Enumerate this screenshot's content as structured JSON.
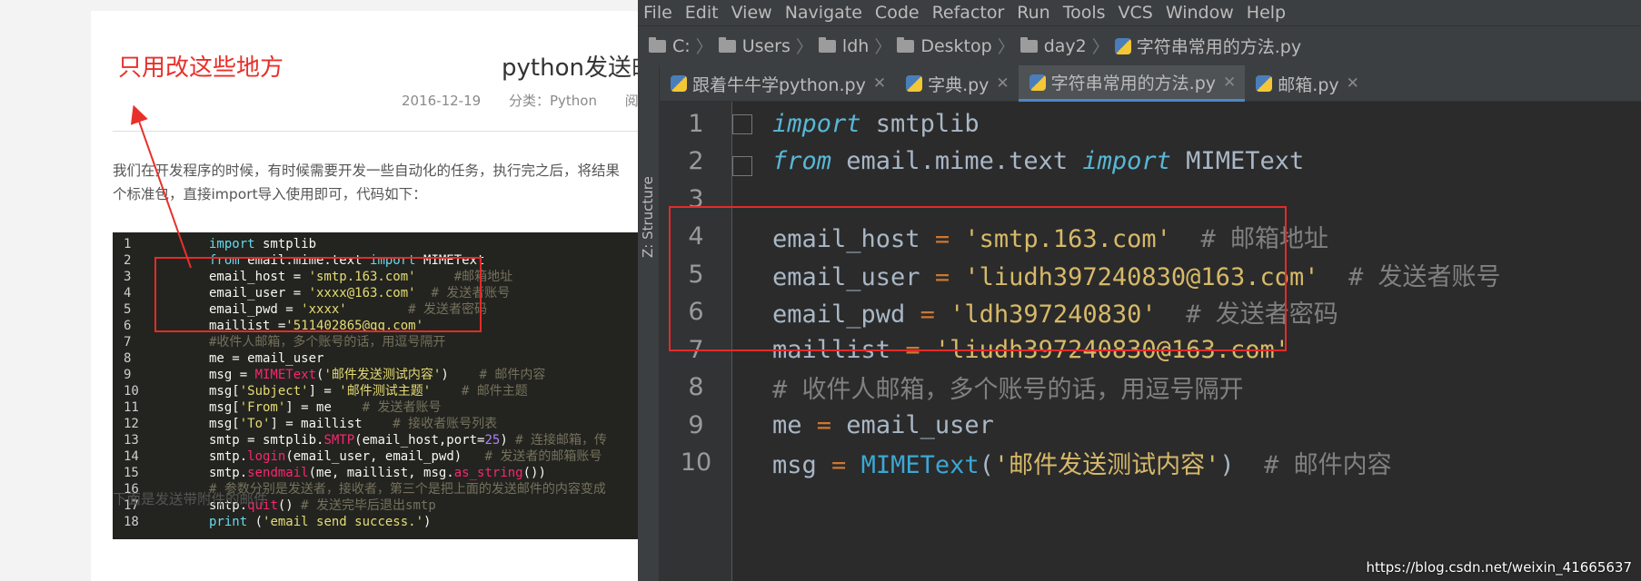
{
  "article": {
    "annotation": "只用改这些地方",
    "title": "python发送邮",
    "date": "2016-12-19",
    "category": "分类：Python",
    "read": "阅读",
    "para1": "我们在开发程序的时候，有时候需要开发一些自动化的任务，执行完之后，将结果",
    "para2": "个标准包，直接import导入使用即可，代码如下：",
    "footer": "下面是发送带附件的邮件"
  },
  "code_left": [
    {
      "n": "1",
      "t": "import smtplib"
    },
    {
      "n": "2",
      "t": "from email.mime.text import MIMEText"
    },
    {
      "n": "3",
      "t": "email_host = 'smtp.163.com'     #邮箱地址"
    },
    {
      "n": "4",
      "t": "email_user = 'xxxx@163.com'  # 发送者账号"
    },
    {
      "n": "5",
      "t": "email_pwd = 'xxxx'        # 发送者密码"
    },
    {
      "n": "6",
      "t": "maillist ='511402865@qq.com'"
    },
    {
      "n": "7",
      "t": "#收件人邮箱，多个账号的话，用逗号隔开"
    },
    {
      "n": "8",
      "t": "me = email_user"
    },
    {
      "n": "9",
      "t": "msg = MIMEText('邮件发送测试内容')    # 邮件内容"
    },
    {
      "n": "10",
      "t": "msg['Subject'] = '邮件测试主题'    # 邮件主题"
    },
    {
      "n": "11",
      "t": "msg['From'] = me    # 发送者账号"
    },
    {
      "n": "12",
      "t": "msg['To'] = maillist    # 接收者账号列表"
    },
    {
      "n": "13",
      "t": "smtp = smtplib.SMTP(email_host,port=25) # 连接邮箱，传"
    },
    {
      "n": "14",
      "t": "smtp.login(email_user, email_pwd)   # 发送者的邮箱账号"
    },
    {
      "n": "15",
      "t": "smtp.sendmail(me, maillist, msg.as_string())"
    },
    {
      "n": "16",
      "t": "# 参数分别是发送者，接收者，第三个是把上面的发送邮件的内容变成"
    },
    {
      "n": "17",
      "t": "smtp.quit() # 发送完毕后退出smtp"
    },
    {
      "n": "18",
      "t": "print ('email send success.')"
    }
  ],
  "ide": {
    "menu": [
      "File",
      "Edit",
      "View",
      "Navigate",
      "Code",
      "Refactor",
      "Run",
      "Tools",
      "VCS",
      "Window",
      "Help"
    ],
    "breadcrumb": [
      "C:",
      "Users",
      "ldh",
      "Desktop",
      "day2",
      "字符串常用的方法.py"
    ],
    "tabs": [
      {
        "label": "跟着牛牛学python.py",
        "active": false
      },
      {
        "label": "字典.py",
        "active": false
      },
      {
        "label": "字符串常用的方法.py",
        "active": true
      },
      {
        "label": "邮箱.py",
        "active": false
      }
    ],
    "structure_label": "Z: Structure",
    "lines": [
      {
        "n": "1",
        "t": "import smtplib"
      },
      {
        "n": "2",
        "t": "from email.mime.text import MIMEText"
      },
      {
        "n": "3",
        "t": ""
      },
      {
        "n": "4",
        "t": "email_host = 'smtp.163.com'  # 邮箱地址"
      },
      {
        "n": "5",
        "t": "email_user = 'liudh397240830@163.com'  # 发送者账号"
      },
      {
        "n": "6",
        "t": "email_pwd = 'ldh397240830'  # 发送者密码"
      },
      {
        "n": "7",
        "t": "maillist = 'liudh397240830@163.com'"
      },
      {
        "n": "8",
        "t": "# 收件人邮箱，多个账号的话，用逗号隔开"
      },
      {
        "n": "9",
        "t": "me = email_user"
      },
      {
        "n": "10",
        "t": "msg = MIMEText('邮件发送测试内容')  # 邮件内容"
      }
    ]
  },
  "watermark": "https://blog.csdn.net/weixin_41665637",
  "colors": {
    "highlight_box": "#e32b2b",
    "ide_bg": "#2b2b2b",
    "code_bg": "#23241f"
  }
}
